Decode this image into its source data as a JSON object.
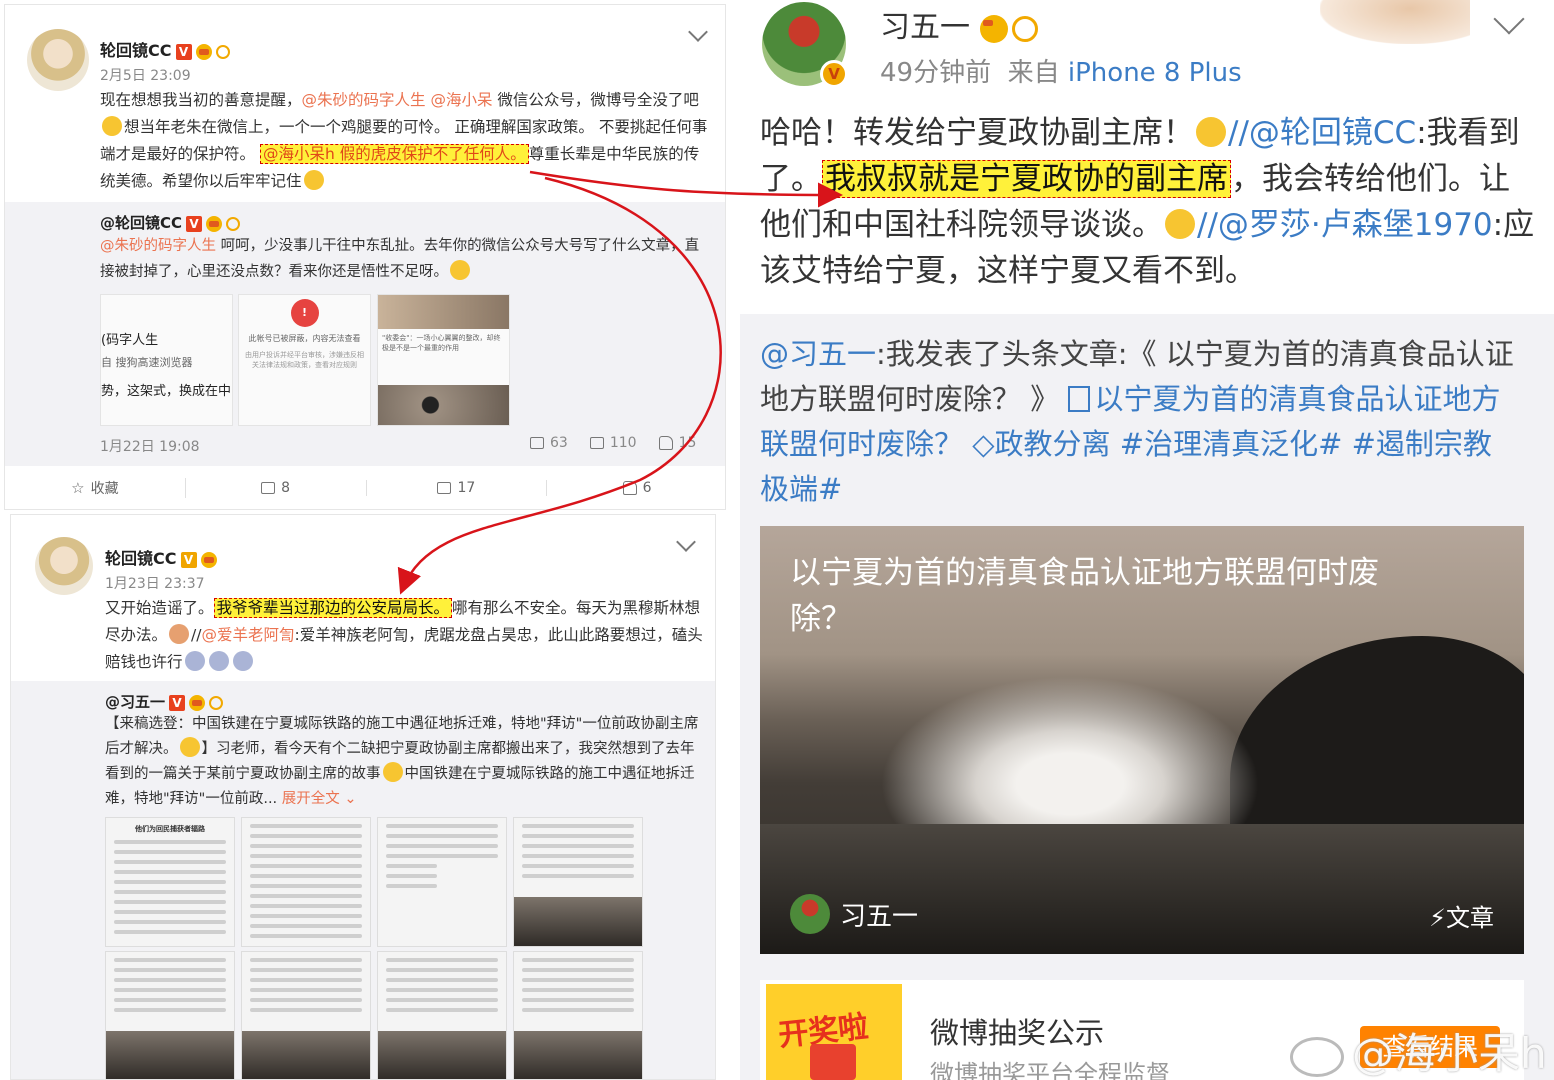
{
  "post1": {
    "username": "轮回镜CC",
    "badge": "V",
    "time": "2月5日 23:09",
    "text_a": "现在想想我当初的善意提醒，",
    "mention_a": "@朱砂的码字人生",
    "mention_b": "@海小呆",
    "text_b": "微信公众号，微博号全没了吧",
    "text_c": "想当年老朱在微信上，一个一个鸡腿要的可怜。 正确理解国家政策。 不要挑起任何事端才是最好的保护符。",
    "highlight_mention": "@海小呆h",
    "highlight_text": "假的虎皮保护不了任何人。",
    "text_d": "尊重长辈是中华民族的传统美德。希望你以后牢牢记住",
    "repost": {
      "username": "@轮回镜CC",
      "mention": "@朱砂的码字人生",
      "text": "呵呵，少没事儿干往中东乱扯。去年你的微信公众号大号写了什么文章，直接被封掉了，心里还没点数？看来你还是悟性不足呀。",
      "thumb1_lines": [
        "(码字人生",
        "自 搜狗高速浏览器",
        "势，这架式，换成在中"
      ],
      "thumb2_title": "此帐号已被屏蔽，内容无法查看",
      "thumb2_sub": "由用户投诉并经平台审核，涉嫌违反相关法律法规和政策，查看对应规则",
      "thumb3_quote": "\"收委会\"：一场小心翼翼的整改，却终极是不是一个最重的作用",
      "time": "1月22日 19:08",
      "reposts": "63",
      "comments": "110",
      "likes": "15"
    },
    "actions": {
      "favorite": "收藏",
      "repost": "8",
      "comment": "17",
      "like": "6"
    }
  },
  "post2": {
    "username": "轮回镜CC",
    "badge": "V",
    "time": "1月23日 23:37",
    "text_a": "又开始造谣了。",
    "highlight": "我爷爷辈当过那边的公安局局长。",
    "text_b": "哪有那么不安全。每天为黑穆斯林想尽办法。",
    "mention": "@爱羊老阿訇",
    "text_c": ":爱羊神族老阿訇，虎踞龙盘占昊忠，此山此路要想过，磕头赔钱也许行",
    "repost": {
      "username": "@习五一",
      "text": "【来稿选登：中国铁建在宁夏城际铁路的施工中遇征地拆迁难，特地\"拜访\"一位前政协副主席后才解决。",
      "text2": "】习老师，看今天有个二缺把宁夏政协副主席都搬出来了，我突然想到了去年看到的一篇关于某前宁夏政协副主席的故事",
      "text3": "中国铁建在宁夏城际铁路的施工中遇征地拆迁难，特地\"拜访\"一位前政...",
      "expand": "展开全文",
      "grid_title": "他们为回民捕获者辐路"
    }
  },
  "post3": {
    "username": "习五一",
    "badge": "V",
    "time": "49分钟前",
    "source_prefix": "来自",
    "source": "iPhone 8 Plus",
    "text_a": "哈哈！转发给宁夏政协副主席！",
    "mention_a": "//@轮回镜CC",
    "text_b": ":我看到了。",
    "highlight": "我叔叔就是宁夏政协的副主席",
    "text_c": "，我会转给他们。让他们和中国社科院领导谈谈。",
    "mention_b": "//@罗莎·卢森堡1970",
    "text_d": ":应该艾特给宁夏，这样宁夏又看不到。",
    "repost_mention": "@习五一",
    "repost_text": ":我发表了头条文章:《 以宁夏为首的清真食品认证地方联盟何时废除？ 》",
    "article_link": "以宁夏为首的清真食品认证地方联盟何时废除？",
    "tag_a": "政教分离",
    "tag_b": "#治理清真泛化#",
    "tag_c": "#遏制宗教极端#",
    "article_card": {
      "title": "以宁夏为首的清真食品认证地方联盟何时废除？",
      "author": "习五一",
      "type": "文章"
    },
    "lottery": {
      "icon_text": "开奖啦",
      "title": "微博抽奖公示",
      "subtitle": "微博抽奖平台全程监督",
      "button": "查看结果"
    }
  },
  "watermark": "@海小呆h",
  "colors": {
    "mention": "#eb7350",
    "link": "#3b7cc5",
    "highlight": "#fff13a",
    "arrow": "#d8141a"
  }
}
